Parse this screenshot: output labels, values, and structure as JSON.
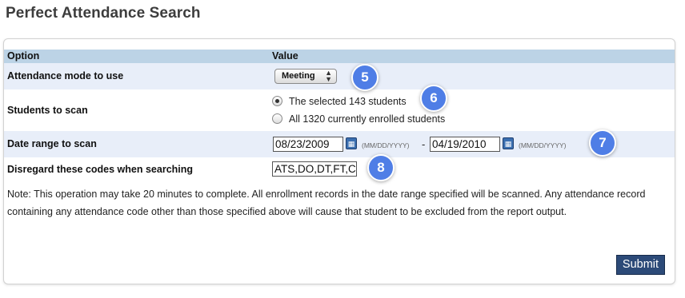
{
  "page": {
    "title": "Perfect Attendance Search"
  },
  "table": {
    "header": {
      "option": "Option",
      "value": "Value"
    },
    "attendance_mode": {
      "label": "Attendance mode to use",
      "selected": "Meeting"
    },
    "students": {
      "label": "Students to scan",
      "options": [
        {
          "label": "The selected 143 students",
          "selected": true
        },
        {
          "label": "All 1320 currently enrolled students",
          "selected": false
        }
      ]
    },
    "date_range": {
      "label": "Date range to scan",
      "start": "08/23/2009",
      "end": "04/19/2010",
      "format_hint": "(MM/DD/YYYY)",
      "separator": "-"
    },
    "codes": {
      "label": "Disregard these codes when searching",
      "value": "ATS,DO,DT,FT,C"
    }
  },
  "note": "Note: This operation may take 20 minutes to complete. All enrollment records in the date range specified will be scanned. Any attendance record containing any attendance code other than those specified above will cause that student to be excluded from the report output.",
  "submit_label": "Submit",
  "badges": [
    "5",
    "6",
    "7",
    "8"
  ],
  "icons": {
    "calendar": "calendar-icon",
    "select_arrows": "updown-arrows-icon"
  },
  "colors": {
    "header_bg": "#bcd3e6",
    "stripe_bg": "#e8eef9",
    "submit_bg": "#2c4a78",
    "badge_bg": "#4f7ee6"
  }
}
